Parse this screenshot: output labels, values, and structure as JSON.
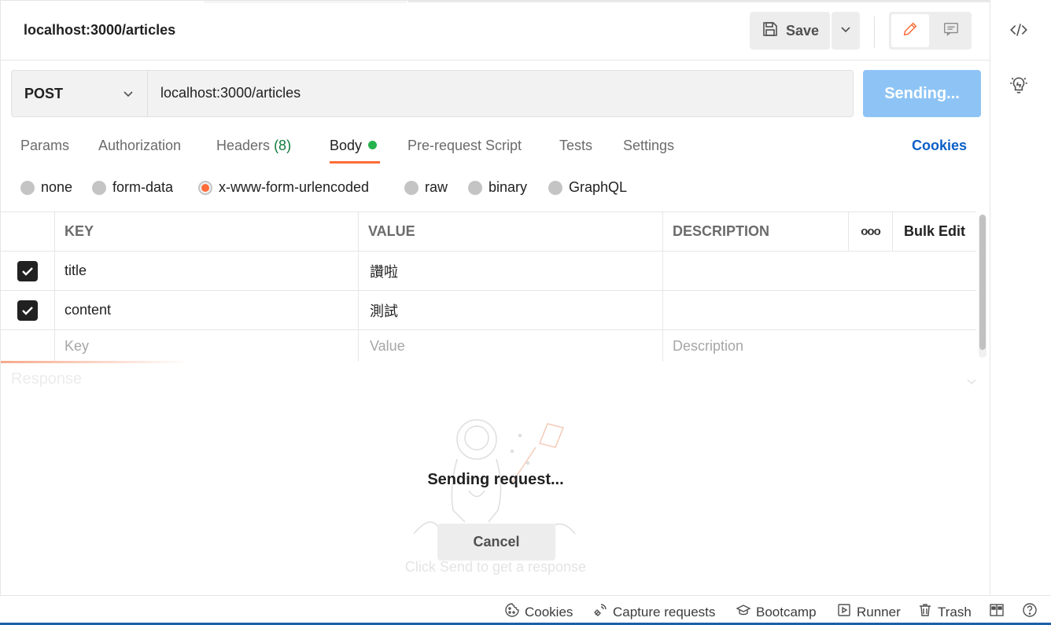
{
  "header": {
    "title": "localhost:3000/articles",
    "save_label": "Save"
  },
  "request": {
    "method": "POST",
    "url": "localhost:3000/articles",
    "send_label": "Sending..."
  },
  "tabs": [
    {
      "label": "Params"
    },
    {
      "label": "Authorization"
    },
    {
      "label": "Headers",
      "count": "(8)"
    },
    {
      "label": "Body"
    },
    {
      "label": "Pre-request Script"
    },
    {
      "label": "Tests"
    },
    {
      "label": "Settings"
    }
  ],
  "cookies_link": "Cookies",
  "body_modes": [
    {
      "label": "none"
    },
    {
      "label": "form-data"
    },
    {
      "label": "x-www-form-urlencoded",
      "selected": true
    },
    {
      "label": "raw"
    },
    {
      "label": "binary"
    },
    {
      "label": "GraphQL"
    }
  ],
  "table": {
    "headers": {
      "key": "KEY",
      "value": "VALUE",
      "description": "DESCRIPTION",
      "more": "ooo",
      "bulk_edit": "Bulk Edit"
    },
    "rows": [
      {
        "key": "title",
        "value": "讚啦",
        "description": ""
      },
      {
        "key": "content",
        "value": "測試",
        "description": ""
      }
    ],
    "placeholders": {
      "key": "Key",
      "value": "Value",
      "description": "Description"
    }
  },
  "response": {
    "label": "Response",
    "status_text": "Sending request...",
    "cancel_label": "Cancel",
    "hint": "Click Send to get a response"
  },
  "status_bar": {
    "cookies": "Cookies",
    "capture": "Capture requests",
    "bootcamp": "Bootcamp",
    "runner": "Runner",
    "trash": "Trash"
  },
  "colors": {
    "accent": "#ff6c37",
    "send_button": "#8ec4f5",
    "link": "#0b5fc7",
    "indicator_green": "#26b34e"
  }
}
